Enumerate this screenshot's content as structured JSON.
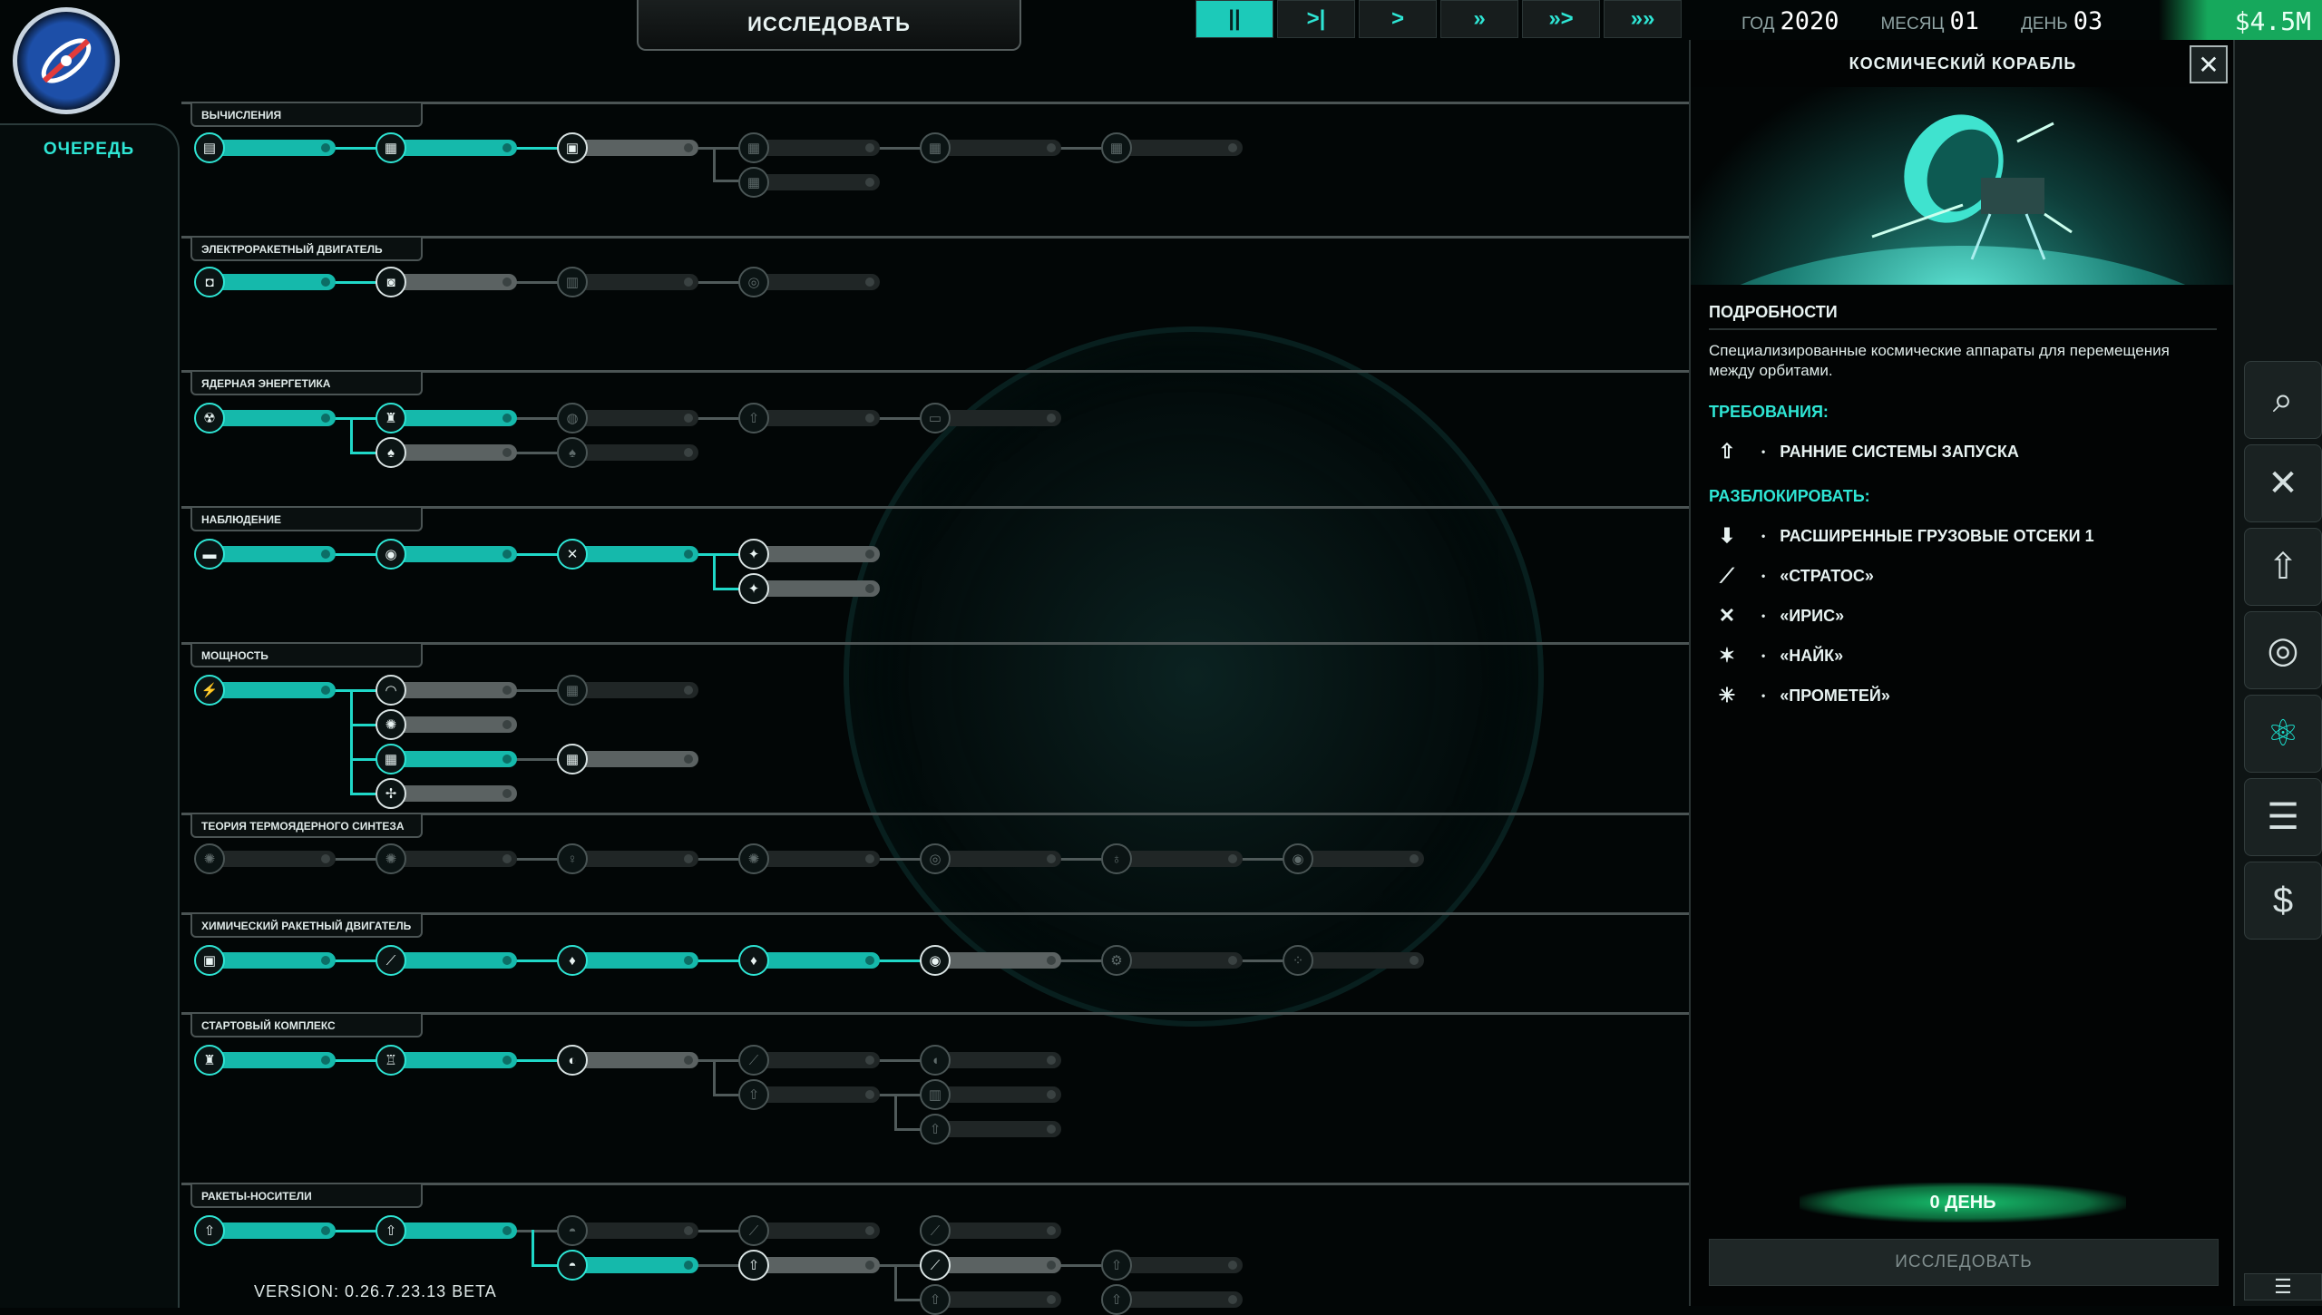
{
  "top": {
    "research_label": "ИССЛЕДОВАТЬ",
    "speed_buttons": [
      "||",
      ">|",
      ">",
      "»",
      "»>",
      "»»"
    ],
    "date": {
      "year_label": "ГОД",
      "year": "2020",
      "month_label": "МЕСЯЦ",
      "month": "01",
      "day_label": "ДЕНЬ",
      "day": "03"
    },
    "money": "$4.5M"
  },
  "queue": {
    "label": "ОЧЕРЕДЬ"
  },
  "version": "VERSION: 0.26.7.23.13 BETA",
  "categories": [
    {
      "title": "ВЫЧИСЛЕНИЯ"
    },
    {
      "title": "ЭЛЕКТРОРАКЕТНЫЙ ДВИГАТЕЛЬ"
    },
    {
      "title": "ЯДЕРНАЯ ЭНЕРГЕТИКА"
    },
    {
      "title": "НАБЛЮДЕНИЕ"
    },
    {
      "title": "МОЩНОСТЬ"
    },
    {
      "title": "ТЕОРИЯ ТЕРМОЯДЕРНОГО СИНТЕЗА"
    },
    {
      "title": "ХИМИЧЕСКИЙ РАКЕТНЫЙ ДВИГАТЕЛЬ"
    },
    {
      "title": "СТАРТОВЫЙ КОМПЛЕКС"
    },
    {
      "title": "РАКЕТЫ-НОСИТЕЛИ"
    }
  ],
  "panel": {
    "title": "КОСМИЧЕСКИЙ КОРАБЛЬ",
    "details_heading": "ПОДРОБНОСТИ",
    "description": "Специализированные космические аппараты для перемещения между орбитами.",
    "requirements_heading": "ТРЕБОВАНИЯ:",
    "requirements": [
      "РАННИЕ СИСТЕМЫ ЗАПУСКА"
    ],
    "unlocks_heading": "РАЗБЛОКИРОВАТЬ:",
    "unlocks": [
      "РАСШИРЕННЫЕ ГРУЗОВЫЕ ОТСЕКИ 1",
      "«СТРАТОС»",
      "«ИРИС»",
      "«НАЙК»",
      "«ПРОМЕТЕЙ»"
    ],
    "days": "0 ДЕНЬ",
    "research_button": "ИССЛЕДОВАТЬ"
  },
  "icons": {
    "search": "search-icon",
    "satellite": "satellite-icon",
    "rocket": "rocket-icon",
    "orbit": "orbit-icon",
    "atom": "atom-icon",
    "finance": "finance-icon",
    "budget": "budget-icon",
    "menu": "menu-icon"
  },
  "colors": {
    "accent": "#1ccab9",
    "money": "#16a85c"
  }
}
